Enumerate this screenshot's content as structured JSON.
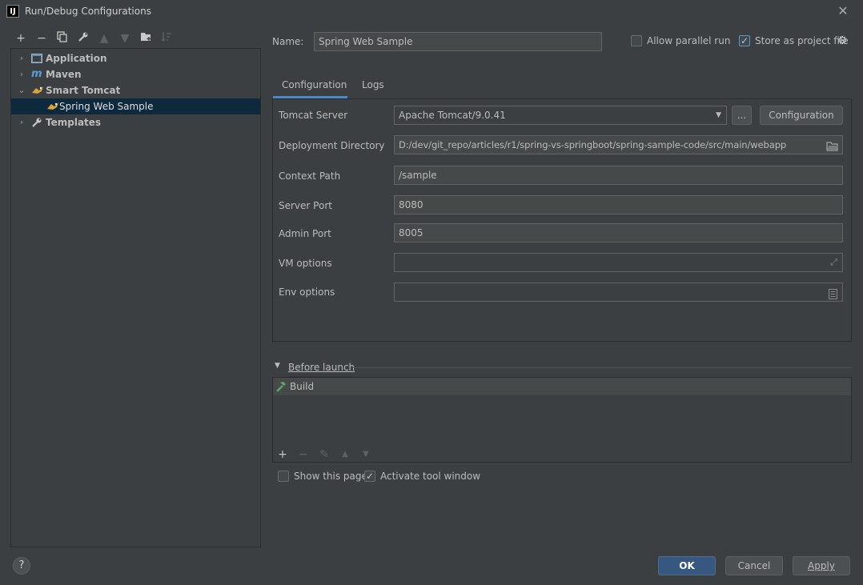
{
  "window": {
    "title": "Run/Debug Configurations",
    "app_icon": "IJ"
  },
  "left_toolbar": {
    "icons": [
      "add-icon",
      "remove-icon",
      "copy-icon",
      "wrench-icon",
      "move-up-icon",
      "move-down-icon",
      "new-folder-icon",
      "sort-icon"
    ]
  },
  "tree": {
    "items": [
      {
        "label": "Application",
        "icon": "application-icon",
        "arrow": "›"
      },
      {
        "label": "Maven",
        "icon": "maven-icon",
        "arrow": "›"
      },
      {
        "label": "Smart Tomcat",
        "icon": "tomcat-icon",
        "arrow": "⌄"
      },
      {
        "label": "Spring Web Sample",
        "icon": "tomcat-icon"
      },
      {
        "label": "Templates",
        "icon": "wrench-icon",
        "arrow": "›"
      }
    ]
  },
  "header": {
    "name_label": "Name:",
    "name_value": "Spring Web Sample",
    "allow_parallel_label": "Allow parallel run",
    "allow_parallel_checked": false,
    "store_label": "Store as project file",
    "store_checked": true
  },
  "tabs": [
    {
      "label": "Configuration",
      "active": true
    },
    {
      "label": "Logs",
      "active": false
    }
  ],
  "config": {
    "tomcat_server_label": "Tomcat Server",
    "tomcat_server_value": "Apache Tomcat/9.0.41",
    "ellipsis_label": "...",
    "configuration_button": "Configuration",
    "deployment_dir_label": "Deployment Directory",
    "deployment_dir_value": "D:/dev/git_repo/articles/r1/spring-vs-springboot/spring-sample-code/src/main/webapp",
    "context_path_label": "Context Path",
    "context_path_value": "/sample",
    "server_port_label": "Server Port",
    "server_port_value": "8080",
    "admin_port_label": "Admin Port",
    "admin_port_value": "8005",
    "vm_options_label": "VM options",
    "vm_options_value": "",
    "env_options_label": "Env options",
    "env_options_value": ""
  },
  "before_launch": {
    "title": "Before launch",
    "items": [
      {
        "label": "Build",
        "icon": "build-hammer-icon"
      }
    ],
    "toolbar_icons": [
      "add-icon",
      "remove-icon",
      "edit-icon",
      "move-up-icon",
      "move-down-icon"
    ]
  },
  "options": {
    "show_page_label": "Show this page",
    "show_page_checked": false,
    "activate_tool_label": "Activate tool window",
    "activate_tool_checked": true
  },
  "footer": {
    "help_label": "?",
    "ok_label": "OK",
    "cancel_label": "Cancel",
    "apply_label": "Apply"
  },
  "colors": {
    "background": "#3c3f41",
    "selection": "#0d293e",
    "accent": "#4a88c7",
    "primary_button": "#365880"
  }
}
